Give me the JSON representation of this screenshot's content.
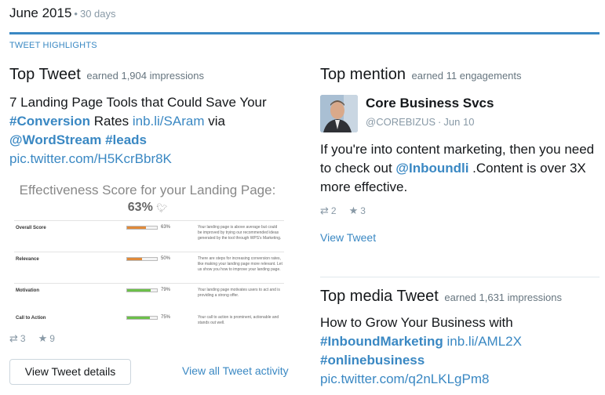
{
  "header": {
    "month": "June 2015",
    "range": "30 days"
  },
  "section_title": "TWEET HIGHLIGHTS",
  "top_tweet": {
    "heading": "Top Tweet",
    "meta": "earned 1,904 impressions",
    "text": {
      "part1": "7 Landing Page Tools that Could Save Your ",
      "tag1": "#Conversion",
      "part2": " Rates ",
      "link1": "inb.li/SAram",
      "part3": " via ",
      "mention": "@WordStream",
      "part4": " ",
      "tag2": "#leads",
      "link2": "pic.twitter.com/H5KcrBbr8K"
    },
    "embed": {
      "title": "Effectiveness Score for your Landing Page:",
      "score": "63%",
      "rows": [
        {
          "label": "Overall Score",
          "pct": "63%",
          "fill": 0.63,
          "color": "#e08a3a",
          "desc": "Your landing page is above average but could be improved by trying our recommended ideas generated by the tool through WPS's Marketing."
        },
        {
          "label": "Relevance",
          "pct": "50%",
          "fill": 0.5,
          "color": "#e08a3a",
          "desc": "There are steps for increasing conversion rates, like making your landing page more relevant. Let us show you how to improve your landing page."
        },
        {
          "label": "Motivation",
          "pct": "79%",
          "fill": 0.79,
          "color": "#6cc04a",
          "desc": "Your landing page motivates users to act and is providing a strong offer."
        },
        {
          "label": "Call to Action",
          "pct": "75%",
          "fill": 0.75,
          "color": "#6cc04a",
          "desc": "Your call to action is prominent, actionable and stands out well."
        }
      ]
    },
    "retweets": "3",
    "favorites": "9",
    "details_button": "View Tweet details",
    "activity_link": "View all Tweet activity"
  },
  "top_mention": {
    "heading": "Top mention",
    "meta": "earned 11 engagements",
    "name": "Core Business Svcs",
    "handle": "@COREBIZUS",
    "date": "Jun 10",
    "text": {
      "part1": "If you're into content marketing, then  you need to check out ",
      "mention": "@Inboundli",
      "part2": " .Content is over 3X more effective."
    },
    "retweets": "2",
    "favorites": "3",
    "view_link": "View Tweet"
  },
  "top_media": {
    "heading": "Top media Tweet",
    "meta": "earned 1,631 impressions",
    "text": {
      "part1": "How to Grow Your Business with ",
      "tag1": "#InboundMarketing",
      "part2": " ",
      "link1": "inb.li/AML2X",
      "tag2": "#onlinebusiness",
      "link2": "pic.twitter.com/q2nLKLgPm8"
    }
  },
  "icons": {
    "retweet": "retweet-icon",
    "favorite": "star-icon",
    "bird": "twitter-bird-icon"
  },
  "colors": {
    "accent": "#3a88c3",
    "text": "#14171a",
    "muted": "#8899a6"
  }
}
